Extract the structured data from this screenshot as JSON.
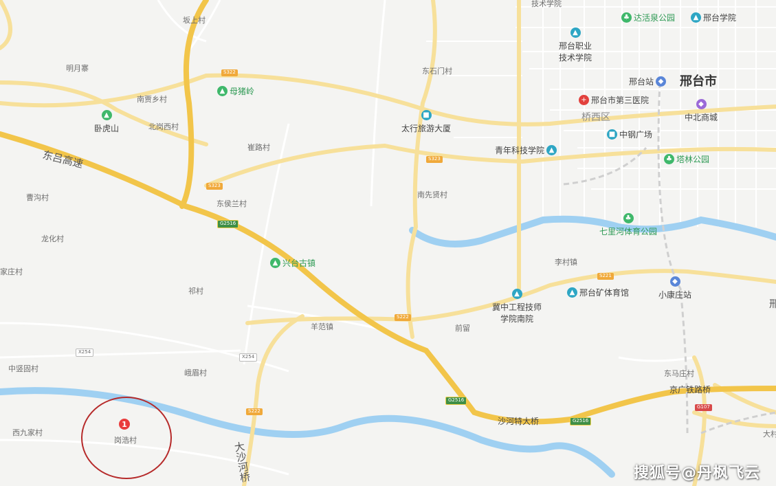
{
  "map_labels": {
    "poshang": "坂上村",
    "mingyuezhai": "明月寨",
    "nanjiaxiang": "南贾乡村",
    "beigangxi": "北岗西村",
    "cuilu": "崔路村",
    "donghoulan": "东侯兰村",
    "caogou": "曹沟村",
    "longhua": "龙化村",
    "jiazhuang": "家庄村",
    "qi": "祁村",
    "zhongjiangu": "中竖固村",
    "houzhao": "峨眉村",
    "xijiujia": "西九家村",
    "gangjie": "岗浩村",
    "yangfan": "羊范镇",
    "nanxianxian": "南先贤村",
    "dongshimen": "东石门村",
    "licun": "李村镇",
    "qianliu": "前留",
    "dongma": "东马庄村",
    "dagao": "大村",
    "xingtai_city": "邢台市",
    "qiaoxi": "桥西区",
    "dongjiu_hw": "东吕高速",
    "dasha_bridge": "大沙河桥",
    "jingguang": "京广铁路桥",
    "shahe_bridge": "沙河特大桥",
    "top_jishu": "技术学院",
    "xing_right": "邢"
  },
  "pois": {
    "muzhuling": "母猪岭",
    "wohushan": "卧虎山",
    "xingtai_gu": "兴台古镇",
    "taihang": "太行旅游大厦",
    "qingnian": "青年科技学院",
    "dahuo": "达活泉公园",
    "xingxue": "邢台学院",
    "zhiye": "邢台职业\n技术学院",
    "xingzhan": "邢台站",
    "sanyuan": "邢台市第三医院",
    "zhongbei": "中北商城",
    "zhonggang": "中钢广场",
    "talin": "塔林公园",
    "qilihe": "七里河体育公园",
    "kuangti": "邢台矿体育馆",
    "xiaokang": "小康庄站",
    "jizhong": "冀中工程技师\n学院南院"
  },
  "shields": {
    "s322": "S322",
    "s323a": "S323",
    "s323b": "S323",
    "g2516a": "G2516",
    "g2516b": "G2516",
    "g2516c": "G2516",
    "s222a": "S222",
    "s222b": "S222",
    "s221": "S221",
    "x254a": "X254",
    "x254b": "X254",
    "g107": "G107"
  },
  "marker": {
    "number": "1"
  },
  "watermark": "搜狐号@丹枫飞云",
  "colors": {
    "background": "#f4f4f2",
    "river": "#9fd0f2",
    "highway": "#f2c54a",
    "provincial": "#f7e09a",
    "minor_road": "#ffffff",
    "circle": "#b62a2a"
  }
}
